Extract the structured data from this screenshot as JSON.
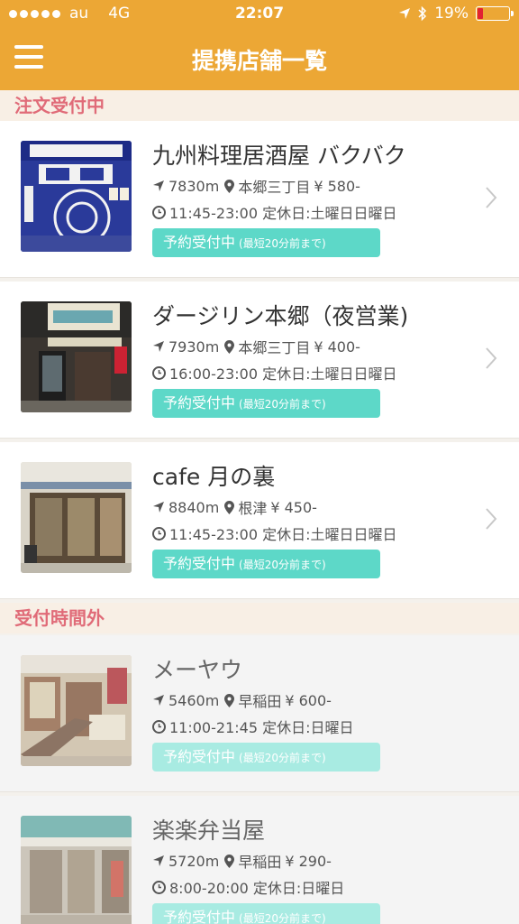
{
  "status": {
    "carrier": "au",
    "network": "4G",
    "time": "22:07",
    "battery": "19%",
    "battery_level": 0.19,
    "battery_color": "#e22233"
  },
  "header": {
    "title": "提携店舗一覧",
    "bg_color": "#eca735"
  },
  "sections": {
    "open": {
      "label": "注文受付中"
    },
    "closed": {
      "label": "受付時間外"
    }
  },
  "stores": [
    {
      "name": "九州料理居酒屋 バクバク",
      "distance": "7830m",
      "area": "本郷三丁目",
      "price": "¥ 580-",
      "hours": "11:45-23:00 定休日:土曜日日曜日",
      "badge": "予約受付中",
      "badge_note": "(最短20分前まで)"
    },
    {
      "name": "ダージリン本郷（夜営業)",
      "distance": "7930m",
      "area": "本郷三丁目",
      "price": "¥ 400-",
      "hours": "16:00-23:00 定休日:土曜日日曜日",
      "badge": "予約受付中",
      "badge_note": "(最短20分前まで)"
    },
    {
      "name": "cafe 月の裏",
      "distance": "8840m",
      "area": "根津",
      "price": "¥ 450-",
      "hours": "11:45-23:00 定休日:土曜日日曜日",
      "badge": "予約受付中",
      "badge_note": "(最短20分前まで)"
    },
    {
      "name": "メーヤウ",
      "distance": "5460m",
      "area": "早稲田",
      "price": "¥ 600-",
      "hours": "11:00-21:45 定休日:日曜日",
      "badge": "予約受付中",
      "badge_note": "(最短20分前まで)"
    },
    {
      "name": "楽楽弁当屋",
      "distance": "5720m",
      "area": "早稲田",
      "price": "¥ 290-",
      "hours": "8:00-20:00 定休日:日曜日",
      "badge": "予約受付中",
      "badge_note": "(最短20分前まで)"
    }
  ],
  "colors": {
    "badge": "#5dd8c8",
    "section_text": "#e06b78",
    "section_bg": "#f8efe5"
  }
}
